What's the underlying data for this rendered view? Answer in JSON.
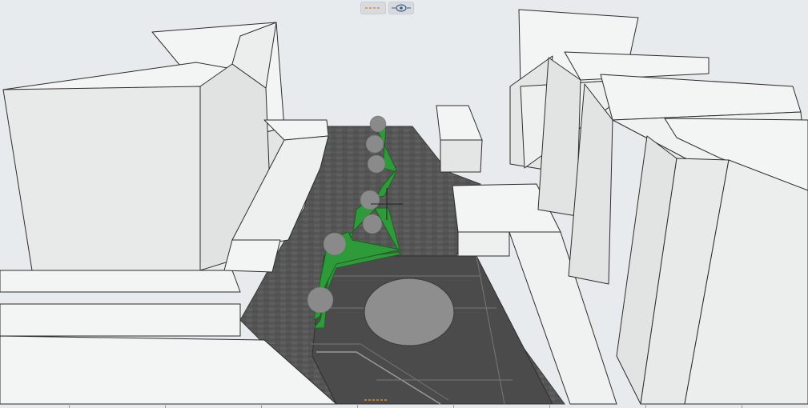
{
  "app": {
    "view_mode": "perspective-3d"
  },
  "toolbar": {
    "buttons": [
      {
        "name": "section-line-toggle",
        "icon": "dashed-line-icon",
        "accent": "#e58a2e"
      },
      {
        "name": "visibility-toggle",
        "icon": "eye-icon",
        "accent": "#3a5f86"
      }
    ]
  },
  "colors": {
    "background": "#e7ebee",
    "building_top": "#f3f4f4",
    "building_side": "#e4e6e6",
    "pavement": "#5a5a5a",
    "plaza": "#4a4a4a",
    "grass": "#2f9a3a",
    "circle": "#8e8e8e",
    "tree": "#8a8a8a"
  }
}
